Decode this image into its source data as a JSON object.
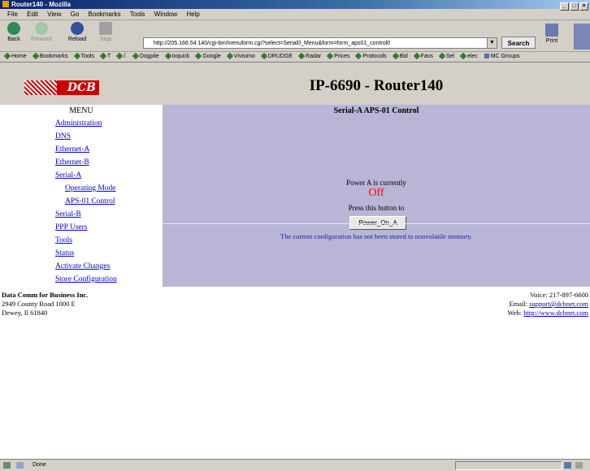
{
  "window": {
    "title": "Router140 - Mozilla",
    "controls": [
      "_",
      "□",
      "×"
    ]
  },
  "menubar": [
    "File",
    "Edit",
    "View",
    "Go",
    "Bookmarks",
    "Tools",
    "Window",
    "Help"
  ],
  "toolbar": {
    "back": "Back",
    "forward": "Forward",
    "reload": "Reload",
    "stop": "Stop",
    "url": "http://205.166.54.140/cgi-bin/menuform.cgi?select=Serial0_Menu&form=form_aps01_control0",
    "search": "Search",
    "print": "Print"
  },
  "bookmarks": [
    "Home",
    "Bookmarks",
    "Tools",
    "T",
    "/.",
    "Dogpile",
    "Ixquick",
    "Google",
    "Vivisimo",
    "DRUDGE",
    "Radar",
    "Prices",
    "Protocols",
    "Bid",
    "Favs",
    "Sel",
    "elec",
    "MC Groups"
  ],
  "logo": "DCB",
  "page_title": "IP-6690 - Router140",
  "menu": {
    "heading": "MENU",
    "items": [
      {
        "label": "Administration",
        "level": 1
      },
      {
        "label": "DNS",
        "level": 1
      },
      {
        "label": "Ethernet-A",
        "level": 1
      },
      {
        "label": "Ethernet-B",
        "level": 1
      },
      {
        "label": "Serial-A",
        "level": 1
      },
      {
        "label": "Operating Mode",
        "level": 2
      },
      {
        "label": "APS-01 Control",
        "level": 2
      },
      {
        "label": "Serial-B",
        "level": 1
      },
      {
        "label": "PPP Users",
        "level": 1
      },
      {
        "label": "Tools",
        "level": 1
      },
      {
        "label": "Status",
        "level": 1
      },
      {
        "label": "Activate Changes",
        "level": 1
      },
      {
        "label": "Store Configuration",
        "level": 1
      }
    ]
  },
  "panel": {
    "title": "Serial-A APS-01 Control",
    "power_label": "Power A is currently",
    "power_state": "Off",
    "press_label": "Press this button to",
    "button": "Power_On_A",
    "notice": "The current configuration has not been stored to nonvolatile memory."
  },
  "footer": {
    "company": "Data Comm for Business Inc.",
    "address1": "2949 County Road 1000 E",
    "address2": "Dewey, Il 61840",
    "voice": "Voice: 217-897-6600",
    "email_label": "Email:",
    "email": "support@dcbnet.com",
    "web_label": "Web:",
    "web": "http://www.dcbnet.com"
  },
  "status": {
    "text": "Done"
  }
}
